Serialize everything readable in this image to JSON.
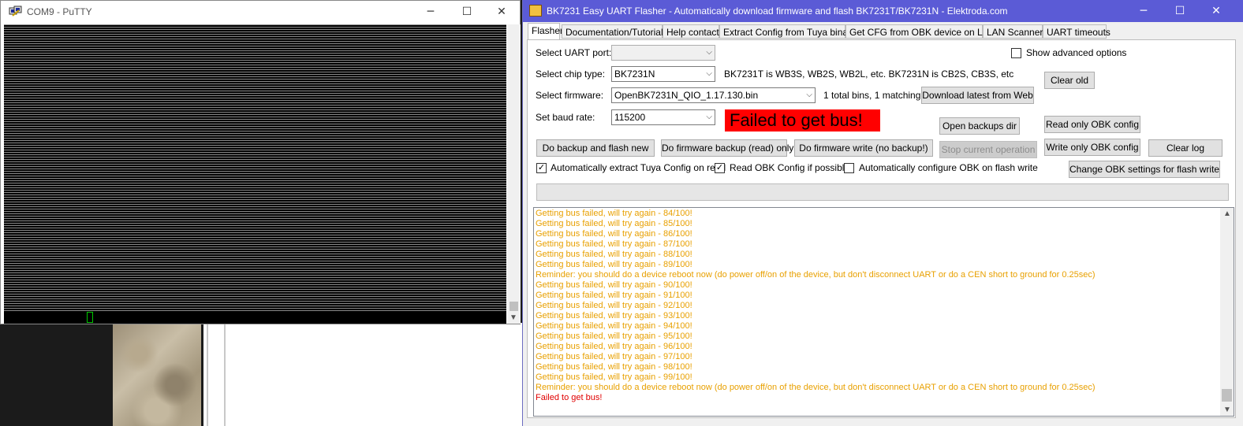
{
  "putty": {
    "title": "COM9 - PuTTY",
    "minimize": "─",
    "maximize": "☐",
    "close": "✕"
  },
  "flasher": {
    "title": "BK7231 Easy UART Flasher - Automatically download firmware and flash BK7231T/BK7231N  - Elektroda.com",
    "minimize": "─",
    "maximize": "☐",
    "close": "✕",
    "tabs": [
      {
        "label": "Flasher",
        "active": true
      },
      {
        "label": "Documentation/Tutorials"
      },
      {
        "label": "Help contact"
      },
      {
        "label": "Extract Config from Tuya binary"
      },
      {
        "label": "Get CFG from OBK device on LAN"
      },
      {
        "label": "LAN Scanner"
      },
      {
        "label": "UART timeouts"
      }
    ],
    "uart_port_label": "Select UART port:",
    "uart_port_value": "",
    "chip_type_label": "Select chip type:",
    "chip_type_value": "BK7231N",
    "chip_info": "BK7231T is WB3S, WB2S, WB2L, etc. BK7231N is CB2S, CB3S, etc",
    "firmware_label": "Select firmware:",
    "firmware_value": "OpenBK7231N_QIO_1.17.130.bin",
    "bins_info": "1 total bins, 1 matching.",
    "baud_label": "Set baud rate:",
    "baud_value": "115200",
    "status_text": "Failed to get bus!",
    "show_advanced_label": "Show advanced options",
    "show_advanced_checked": false,
    "buttons": {
      "download_latest": "Download latest from Web",
      "clear_old": "Clear old",
      "open_backups": "Open backups dir",
      "read_obk": "Read only OBK config",
      "backup_flash": "Do backup and flash new",
      "backup_read": "Do firmware backup (read) only",
      "write_no_backup": "Do firmware write (no backup!)",
      "stop": "Stop current operation",
      "write_obk": "Write only OBK config",
      "clear_log": "Clear log",
      "change_obk": "Change OBK settings for flash write"
    },
    "checks": {
      "auto_extract": "Automatically extract Tuya Config on read",
      "auto_extract_checked": true,
      "read_obk": "Read OBK Config if possible",
      "read_obk_checked": true,
      "auto_config": "Automatically configure OBK on flash write",
      "auto_config_checked": false
    },
    "log": [
      {
        "text": "Getting bus failed, will try again - 84/100!",
        "type": "warn"
      },
      {
        "text": "Getting bus failed, will try again - 85/100!",
        "type": "warn"
      },
      {
        "text": "Getting bus failed, will try again - 86/100!",
        "type": "warn"
      },
      {
        "text": "Getting bus failed, will try again - 87/100!",
        "type": "warn"
      },
      {
        "text": "Getting bus failed, will try again - 88/100!",
        "type": "warn"
      },
      {
        "text": "Getting bus failed, will try again - 89/100!",
        "type": "warn"
      },
      {
        "text": "Reminder: you should do a device reboot now (do power off/on of the device, but don't disconnect UART or do a CEN short to ground for 0.25sec)",
        "type": "warn"
      },
      {
        "text": "Getting bus failed, will try again - 90/100!",
        "type": "warn"
      },
      {
        "text": "Getting bus failed, will try again - 91/100!",
        "type": "warn"
      },
      {
        "text": "Getting bus failed, will try again - 92/100!",
        "type": "warn"
      },
      {
        "text": "Getting bus failed, will try again - 93/100!",
        "type": "warn"
      },
      {
        "text": "Getting bus failed, will try again - 94/100!",
        "type": "warn"
      },
      {
        "text": "Getting bus failed, will try again - 95/100!",
        "type": "warn"
      },
      {
        "text": "Getting bus failed, will try again - 96/100!",
        "type": "warn"
      },
      {
        "text": "Getting bus failed, will try again - 97/100!",
        "type": "warn"
      },
      {
        "text": "Getting bus failed, will try again - 98/100!",
        "type": "warn"
      },
      {
        "text": "Getting bus failed, will try again - 99/100!",
        "type": "warn"
      },
      {
        "text": "Reminder: you should do a device reboot now (do power off/on of the device, but don't disconnect UART or do a CEN short to ground for 0.25sec)",
        "type": "warn"
      },
      {
        "text": "Failed to get bus!",
        "type": "err"
      }
    ]
  },
  "colors": {
    "titlebar": "#5b5bd6",
    "warn": "#e8a000",
    "error": "#e00000",
    "status_bg": "#ff0000"
  }
}
